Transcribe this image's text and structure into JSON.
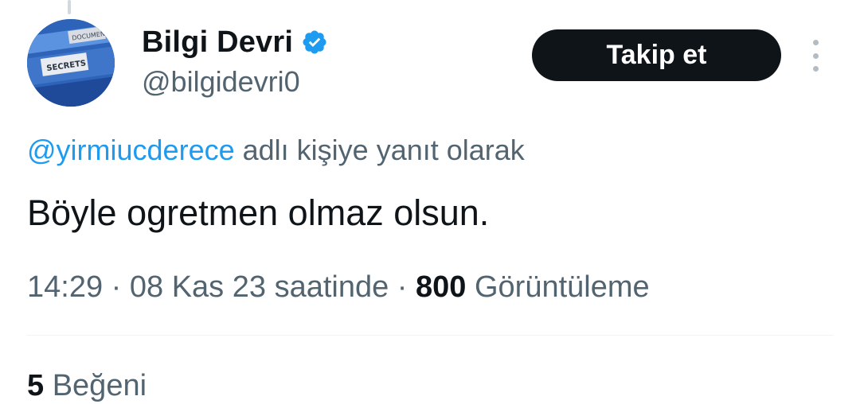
{
  "author": {
    "display_name": "Bilgi Devri",
    "handle": "@bilgidevri0",
    "verified": true,
    "avatar_label_top": "DOCUMENTS",
    "avatar_label_main": "SECRETS"
  },
  "actions": {
    "follow_label": "Takip et",
    "more_icon": "more-vertical-icon"
  },
  "reply_context": {
    "mention": "@yirmiucderece",
    "suffix": " adlı kişiye yanıt olarak"
  },
  "tweet": {
    "text": "Böyle ogretmen olmaz olsun.",
    "time": "14:29",
    "date": "08 Kas 23 saatinde",
    "separator": "·",
    "views_count": "800",
    "views_label": "Görüntüleme"
  },
  "engagement": {
    "likes_count": "5",
    "likes_label": "Beğeni"
  },
  "colors": {
    "accent": "#1d9bf0",
    "text_primary": "#0f1419",
    "text_secondary": "#536471",
    "button_bg": "#0f1419"
  }
}
